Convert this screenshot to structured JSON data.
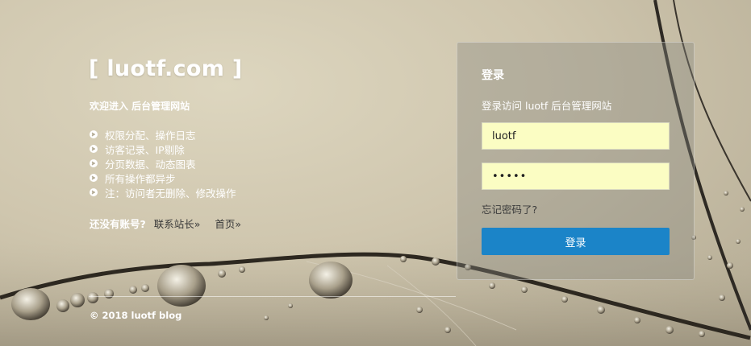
{
  "brand": {
    "title": "[ luotf.com ]"
  },
  "intro": {
    "welcome": "欢迎进入 后台管理网站",
    "features": [
      "权限分配、操作日志",
      "访客记录、IP剔除",
      "分页数据、动态图表",
      "所有操作都异步",
      "注：访问者无删除、修改操作"
    ]
  },
  "signup": {
    "question": "还没有账号?",
    "contact_link": "联系站长»",
    "home_link": "首页»"
  },
  "login": {
    "title": "登录",
    "subtitle": "登录访问 luotf 后台管理网站",
    "username_value": "luotf",
    "password_value": "•••••",
    "forgot_label": "忘记密码了?",
    "submit_label": "登录"
  },
  "footer": {
    "copyright": "© 2018 luotf blog"
  },
  "colors": {
    "primary_button": "#1b84c8",
    "input_bg": "#fbfdc3"
  }
}
